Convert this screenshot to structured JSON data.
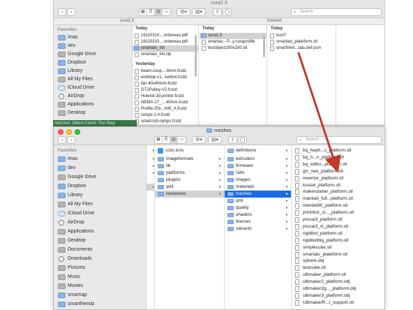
{
  "window1": {
    "title": "cura2.3",
    "search_placeholder": "Search",
    "path_left": "cura2.3",
    "path_right": "fromnet",
    "sidebar": {
      "heading": "Favorites",
      "items": [
        {
          "label": "imac",
          "icon": "folder-icon"
        },
        {
          "label": "dev",
          "icon": "folder-icon"
        },
        {
          "label": "Google Drive",
          "icon": "google-drive-icon"
        },
        {
          "label": "Dropbox",
          "icon": "folder-icon"
        },
        {
          "label": "Library",
          "icon": "folder-icon"
        },
        {
          "label": "All My Files",
          "icon": "all-files-icon"
        },
        {
          "label": "iCloud Drive",
          "icon": "icloud-icon"
        },
        {
          "label": "AirDrop",
          "icon": "airdrop-icon"
        },
        {
          "label": "Applications",
          "icon": "applications-icon"
        },
        {
          "label": "Desktop",
          "icon": "desktop-icon"
        }
      ]
    },
    "col1": {
      "today_label": "Today",
      "today_rows": [
        "16110310....ordereau.pdf",
        "16110310....ordereau.pdf",
        "smartalu_init",
        "smartalu_init.zip"
      ],
      "yesterday_label": "Yesterday",
      "yesterday_rows": [
        "beam-coup...-8mm.fcstd",
        "endstop-v1...kerbot.fcstd",
        "fan-40x40mm.fcstd",
        "GT2Pulley-V2.fcstd",
        "Hotend-3d-printer.fcstd",
        "NEMA-17_....40mm.fcstd",
        "Profile-20x...lot6_A.fcstd",
        "ramps-1.4.fcstd",
        "smart-lcd-ramps.fcstd"
      ]
    },
    "col2": {
      "today_label": "Today",
      "rows": [
        "cura2.3",
        "smartau - P...y.curaprofile",
        "testobject200x200.stl"
      ]
    },
    "col3": {
      "today_label": "Today",
      "rows": [
        "icon?",
        "smartalu_plateform.stl",
        "smartfrien...talu.def.json"
      ]
    }
  },
  "green_strip_text": "Add text. (Word Count: The Step",
  "window2": {
    "title": "meshes",
    "search_placeholder": "Search",
    "sidebar": {
      "heading": "Favorites",
      "items": [
        {
          "label": "imac",
          "icon": "folder-icon"
        },
        {
          "label": "dev",
          "icon": "folder-icon"
        },
        {
          "label": "Google Drive",
          "icon": "google-drive-icon"
        },
        {
          "label": "Dropbox",
          "icon": "folder-icon"
        },
        {
          "label": "Library",
          "icon": "folder-icon"
        },
        {
          "label": "All My Files",
          "icon": "all-files-icon"
        },
        {
          "label": "iCloud Drive",
          "icon": "icloud-icon"
        },
        {
          "label": "AirDrop",
          "icon": "airdrop-icon"
        },
        {
          "label": "Applications",
          "icon": "applications-icon"
        },
        {
          "label": "Desktop",
          "icon": "desktop-icon"
        },
        {
          "label": "Documents",
          "icon": "documents-icon"
        },
        {
          "label": "Downloads",
          "icon": "downloads-icon"
        },
        {
          "label": "Pictures",
          "icon": "pictures-icon"
        },
        {
          "label": "Music",
          "icon": "music-icon"
        },
        {
          "label": "Movies",
          "icon": "movies-icon"
        },
        {
          "label": "smartrap",
          "icon": "folder-icon"
        },
        {
          "label": "smartfriendz",
          "icon": "folder-icon"
        },
        {
          "label": "europehps",
          "icon": "folder-icon"
        }
      ]
    },
    "col_res": {
      "rows": [
        {
          "label": "icon.icns",
          "type": "app"
        },
        {
          "label": "imageformats",
          "type": "folder"
        },
        {
          "label": "lib",
          "type": "folder"
        },
        {
          "label": "platforms",
          "type": "folder"
        },
        {
          "label": "plugins",
          "type": "folder"
        },
        {
          "label": "qml",
          "type": "folder"
        },
        {
          "label": "resources",
          "type": "folder"
        }
      ]
    },
    "col_sub": {
      "rows": [
        "definitions",
        "extruders",
        "firmware",
        "i18n",
        "images",
        "materials",
        "meshes",
        "qml",
        "quality",
        "shaders",
        "themes",
        "variants"
      ]
    },
    "col_meshes": {
      "rows": [
        "bq_heph...s_platform.stl",
        "bq_h...n_platform.stl",
        "bq_witbo...platform.stl",
        "grr_neo_platform.stl",
        "inventor_platform.stl",
        "kossel_platform.stl",
        "makerstarter_platform.stl",
        "mankati_full...platform.stl",
        "mendel90_platform.stl",
        "printrbot_si..._platform.stl",
        "prusai3_platform.stl",
        "prusai3_xl_platform.stl",
        "rigidbot_platform.stl",
        "rigidbotbig_platform.stl",
        "simplecube.stl",
        "smartalu_plateform.stl",
        "sphere.obj",
        "testcube.stl",
        "ultimaker_platform.stl",
        "ultimaker2_platform.obj",
        "ultimaker2g..._platform.obj",
        "ultimaker3_platform.obj",
        "UltimakerR...t_support.stl"
      ]
    }
  },
  "colors": {
    "accent_blue": "#1a6ae3",
    "arrow_red": "#c0392b",
    "green_strip": "#3a7a48"
  }
}
